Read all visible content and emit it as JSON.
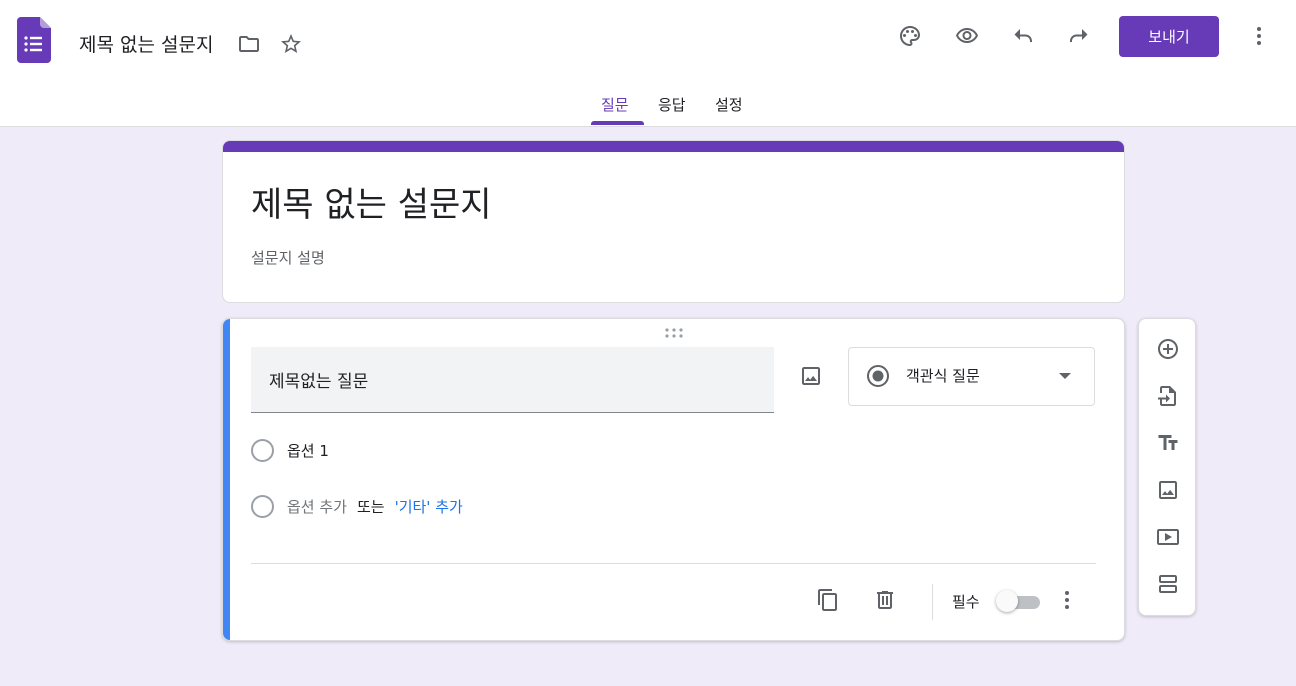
{
  "header": {
    "doc_title": "제목 없는 설문지",
    "send_label": "보내기",
    "brand_color": "#673ab7",
    "icons": [
      "folder-icon",
      "star-icon",
      "palette-icon",
      "preview-eye-icon",
      "undo-icon",
      "redo-icon",
      "more-vert-icon"
    ]
  },
  "tabs": [
    {
      "label": "질문",
      "active": true
    },
    {
      "label": "응답",
      "active": false
    },
    {
      "label": "설정",
      "active": false
    }
  ],
  "form": {
    "title": "제목 없는 설문지",
    "description_placeholder": "설문지 설명"
  },
  "question": {
    "title": "제목없는 질문",
    "type_label": "객관식 질문",
    "options": [
      {
        "label": "옵션 1"
      }
    ],
    "add_option": "옵션 추가",
    "or_text": "또는",
    "add_other": "'기타' 추가",
    "required_label": "필수",
    "required": false
  },
  "side_toolbar": {
    "icons": [
      "add-question-icon",
      "import-questions-icon",
      "add-title-icon",
      "add-image-icon",
      "add-video-icon",
      "add-section-icon"
    ]
  }
}
